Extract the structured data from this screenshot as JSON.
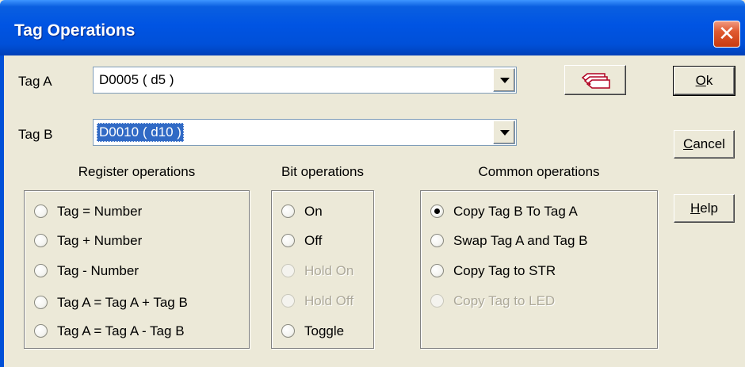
{
  "window": {
    "title": "Tag Operations",
    "close_label": "✕"
  },
  "tagA": {
    "label": "Tag A",
    "value": "D0005 ( d5 )"
  },
  "tagB": {
    "label": "Tag B",
    "value": "D0010 ( d10 )"
  },
  "buttons": {
    "ok": {
      "underlined": "O",
      "rest": "k"
    },
    "cancel": {
      "underlined": "C",
      "rest": "ancel"
    },
    "help": {
      "underlined": "H",
      "rest": "elp"
    },
    "tag_picker_icon": "tags-icon"
  },
  "register_operations": {
    "title": "Register operations",
    "options": [
      {
        "label": "Tag  =  Number",
        "checked": false,
        "enabled": true
      },
      {
        "label": "Tag  +  Number",
        "checked": false,
        "enabled": true
      },
      {
        "label": "Tag  -  Number",
        "checked": false,
        "enabled": true
      },
      {
        "label": "Tag A = Tag A + Tag B",
        "checked": false,
        "enabled": true
      },
      {
        "label": "Tag A = Tag A - Tag B",
        "checked": false,
        "enabled": true
      }
    ]
  },
  "bit_operations": {
    "title": "Bit operations",
    "options": [
      {
        "label": "On",
        "checked": false,
        "enabled": true
      },
      {
        "label": "Off",
        "checked": false,
        "enabled": true
      },
      {
        "label": "Hold On",
        "checked": false,
        "enabled": false
      },
      {
        "label": "Hold Off",
        "checked": false,
        "enabled": false
      },
      {
        "label": "Toggle",
        "checked": false,
        "enabled": true
      }
    ]
  },
  "common_operations": {
    "title": "Common operations",
    "options": [
      {
        "label": "Copy Tag B To Tag A",
        "checked": true,
        "enabled": true
      },
      {
        "label": "Swap Tag A and Tag B",
        "checked": false,
        "enabled": true
      },
      {
        "label": "Copy Tag to STR",
        "checked": false,
        "enabled": true
      },
      {
        "label": "Copy Tag to LED",
        "checked": false,
        "enabled": false
      }
    ]
  },
  "colors": {
    "title_bar": "#0054e3",
    "dialog_bg": "#ece9d8",
    "selection": "#316ac5",
    "close_button": "#e05a30",
    "disabled_text": "#aca899"
  }
}
